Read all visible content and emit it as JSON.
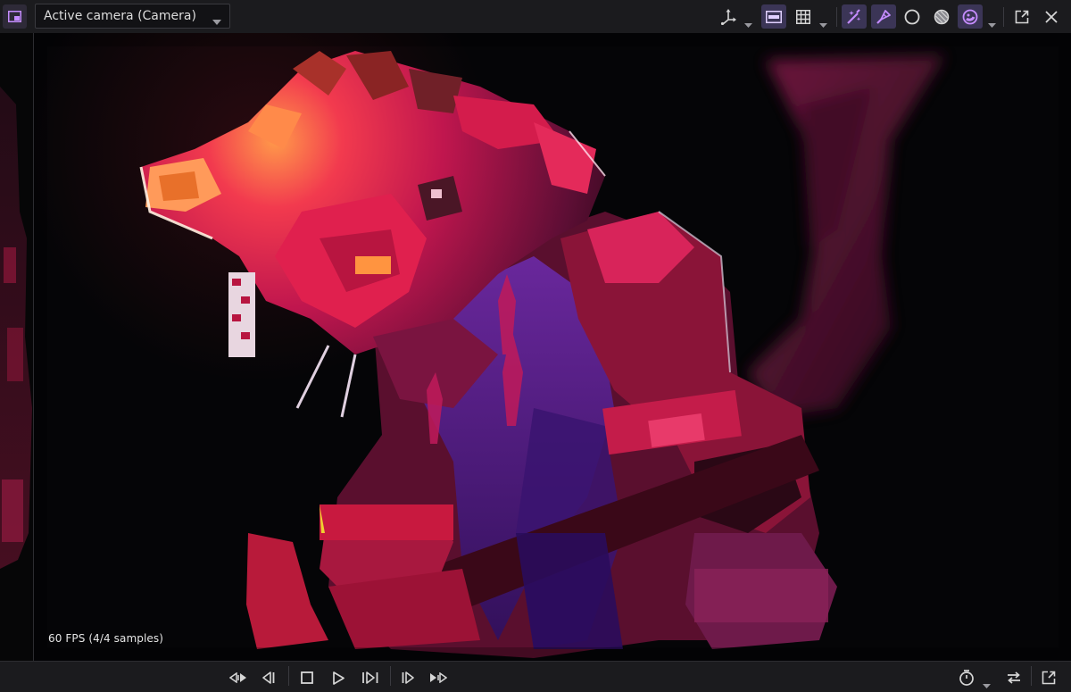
{
  "toolbar": {
    "camera_select": {
      "value": "Active camera (Camera)"
    },
    "icons": [
      "panel-toggle-icon",
      "transform-gizmo-icon",
      "letterbox-icon",
      "grid-icon",
      "shading-wand-icon",
      "lighting-icon",
      "circle-shading-icon",
      "half-sphere-shading-icon",
      "environment-shading-icon",
      "popout-icon",
      "close-icon"
    ]
  },
  "viewport": {
    "fps_text": "60 FPS (4/4 samples)"
  },
  "playback": {
    "icons": [
      "rewind-to-start-icon",
      "step-back-icon",
      "stop-icon",
      "play-icon",
      "step-forward-icon",
      "next-keyframe-icon",
      "fast-forward-icon",
      "timer-icon",
      "loop-icon",
      "export-icon"
    ]
  },
  "colors": {
    "accent": "#b36bff",
    "accent_bg": "#3b3556",
    "toolbar_bg": "#1b1b1e",
    "viewport_bg": "#050507",
    "character_pink": "#d81f5a",
    "character_glow": "#ff7a3a",
    "character_purple": "#4a1f8a"
  }
}
